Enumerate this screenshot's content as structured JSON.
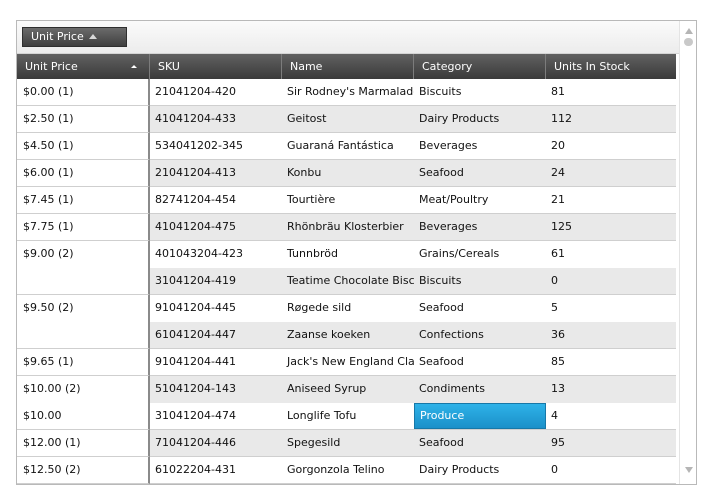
{
  "group_panel": {
    "chip_label": "Unit Price"
  },
  "columns": [
    "Unit Price",
    "SKU",
    "Name",
    "Category",
    "Units In Stock"
  ],
  "groups": [
    {
      "label": "$0.00 (1)",
      "rows": [
        [
          "21041204-420",
          "Sir Rodney's Marmalade",
          "Biscuits",
          "81"
        ]
      ]
    },
    {
      "label": "$2.50 (1)",
      "rows": [
        [
          "41041204-433",
          "Geitost",
          "Dairy Products",
          "112"
        ]
      ]
    },
    {
      "label": "$4.50 (1)",
      "rows": [
        [
          "534041202-345",
          "Guaraná Fantástica",
          "Beverages",
          "20"
        ]
      ]
    },
    {
      "label": "$6.00 (1)",
      "rows": [
        [
          "21041204-413",
          "Konbu",
          "Seafood",
          "24"
        ]
      ]
    },
    {
      "label": "$7.45 (1)",
      "rows": [
        [
          "82741204-454",
          "Tourtière",
          "Meat/Poultry",
          "21"
        ]
      ]
    },
    {
      "label": "$7.75 (1)",
      "rows": [
        [
          "41041204-475",
          "Rhönbräu Klosterbier",
          "Beverages",
          "125"
        ]
      ]
    },
    {
      "label": "$9.00 (2)",
      "rows": [
        [
          "401043204-423",
          "Tunnbröd",
          "Grains/Cereals",
          "61"
        ],
        [
          "31041204-419",
          "Teatime Chocolate Biscuits",
          "Biscuits",
          "0"
        ]
      ]
    },
    {
      "label": "$9.50 (2)",
      "rows": [
        [
          "91041204-445",
          "Røgede sild",
          "Seafood",
          "5"
        ],
        [
          "61041204-447",
          "Zaanse koeken",
          "Confections",
          "36"
        ]
      ]
    },
    {
      "label": "$9.65 (1)",
      "rows": [
        [
          "91041204-441",
          "Jack's New England Clam Chowder",
          "Seafood",
          "85"
        ]
      ]
    },
    {
      "label": "$10.00 (2)",
      "footnote": "$10.00",
      "rows": [
        [
          "51041204-143",
          "Aniseed Syrup",
          "Condiments",
          "13"
        ],
        [
          "31041204-474",
          "Longlife Tofu",
          "Produce",
          "4"
        ]
      ]
    },
    {
      "label": "$12.00 (1)",
      "rows": [
        [
          "71041204-446",
          "Spegesild",
          "Seafood",
          "95"
        ]
      ]
    },
    {
      "label": "$12.50 (2)",
      "rows": [
        [
          "61022204-431",
          "Gorgonzola Telino",
          "Dairy Products",
          "0"
        ]
      ]
    }
  ],
  "selected_cell": {
    "group": 9,
    "row": 1,
    "col": 2
  },
  "colors": {
    "selection": "#1b9ad6",
    "header": "#4a4a4a",
    "alt_row": "#e9e9e9"
  }
}
